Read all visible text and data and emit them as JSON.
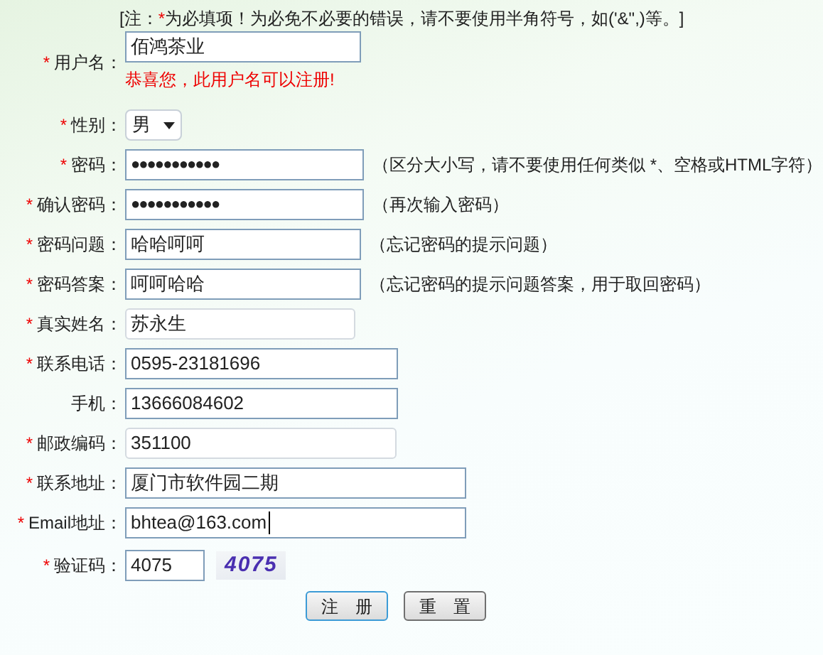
{
  "note": {
    "open": "[注：",
    "star": "*",
    "text": "为必填项！为必免不必要的错误，请不要使用半角符号，如('&\",)等。]"
  },
  "fields": [
    {
      "kind": "text",
      "required": true,
      "label": "用户名：",
      "value": "佰鸿茶业",
      "message": "恭喜您，此用户名可以注册!",
      "focused": false,
      "muted": false
    },
    {
      "kind": "select",
      "required": true,
      "label": "性别：",
      "value": "男",
      "focused": false,
      "muted": false
    },
    {
      "kind": "password",
      "required": true,
      "label": "密码：",
      "value": "●●●●●●●●●●●",
      "hint": "（区分大小写，请不要使用任何类似 *、空格或HTML字符）",
      "focused": false,
      "muted": false
    },
    {
      "kind": "password",
      "required": true,
      "label": "确认密码：",
      "value": "●●●●●●●●●●●",
      "hint": "（再次输入密码）",
      "focused": false,
      "muted": false
    },
    {
      "kind": "text",
      "required": true,
      "label": "密码问题：",
      "value": "哈哈呵呵",
      "hint": "（忘记密码的提示问题）",
      "focused": false,
      "muted": false
    },
    {
      "kind": "text",
      "required": true,
      "label": "密码答案：",
      "value": "呵呵哈哈",
      "hint": "（忘记密码的提示问题答案，用于取回密码）",
      "focused": false,
      "muted": false
    },
    {
      "kind": "text",
      "required": true,
      "label": "真实姓名：",
      "value": "苏永生",
      "focused": false,
      "muted": true
    },
    {
      "kind": "text",
      "required": true,
      "label": "联系电话：",
      "value": "0595-23181696",
      "focused": false,
      "muted": false
    },
    {
      "kind": "text",
      "required": false,
      "label": "手机：",
      "value": "13666084602",
      "focused": false,
      "muted": false
    },
    {
      "kind": "text",
      "required": true,
      "label": "邮政编码：",
      "value": "351100",
      "focused": false,
      "muted": true
    },
    {
      "kind": "text",
      "required": true,
      "label": "联系地址：",
      "value": "厦门市软件园二期",
      "focused": false,
      "muted": false
    },
    {
      "kind": "text",
      "required": true,
      "label": "Email地址：",
      "value": "bhtea@163.com",
      "focused": true,
      "muted": false
    },
    {
      "kind": "captcha",
      "required": true,
      "label": "验证码：",
      "value": "4075",
      "captcha": "4075",
      "focused": false,
      "muted": false
    }
  ],
  "buttons": [
    {
      "label": "注　册",
      "focused": true
    },
    {
      "label": "重　置",
      "focused": false
    }
  ]
}
